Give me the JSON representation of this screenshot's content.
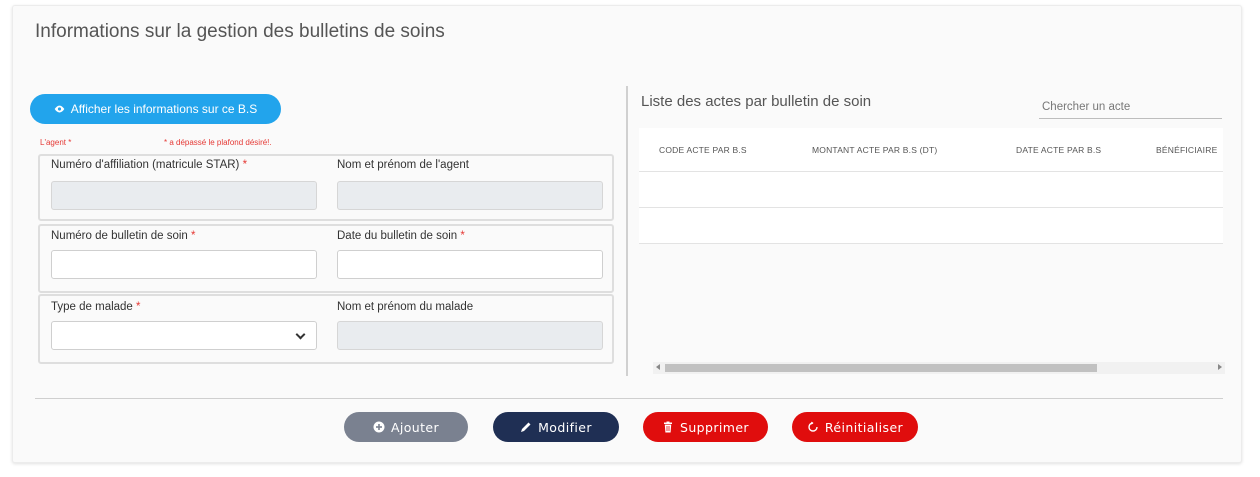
{
  "page": {
    "title": "Informations sur la gestion des bulletins de soins"
  },
  "info_button": {
    "label": "Afficher les informations sur ce B.S"
  },
  "warnings": {
    "agent_label": "L'agent *",
    "message": "* a dépassé le plafond désiré!."
  },
  "form": {
    "affiliation": {
      "label": "Numéro d'affiliation (matricule STAR)",
      "required": "*",
      "value": ""
    },
    "agent_name": {
      "label": "Nom et prénom de l'agent",
      "value": ""
    },
    "bulletin_number": {
      "label": "Numéro de bulletin de soin",
      "required": "*",
      "value": ""
    },
    "bulletin_date": {
      "label": "Date du bulletin de soin",
      "required": "*",
      "value": ""
    },
    "patient_type": {
      "label": "Type de malade",
      "required": "*",
      "value": ""
    },
    "patient_name": {
      "label": "Nom et prénom du malade",
      "value": ""
    }
  },
  "acts_list": {
    "title": "Liste des actes par bulletin de soin",
    "search_placeholder": "Chercher un acte",
    "columns": [
      "CODE ACTE PAR B.S",
      "MONTANT ACTE PAR B.S (DT)",
      "DATE ACTE PAR B.S",
      "BÉNÉFICIAIRE"
    ],
    "rows": [
      [
        "",
        "",
        "",
        ""
      ],
      [
        "",
        "",
        "",
        ""
      ]
    ]
  },
  "actions": {
    "add": "Ajouter",
    "modify": "Modifier",
    "delete": "Supprimer",
    "reset": "Réinitialiser"
  },
  "colors": {
    "primary_blue": "#22a4ec",
    "grey_button": "#7a8190",
    "navy_button": "#1f2f54",
    "danger_red": "#e00d0d",
    "required_red": "#e53935"
  }
}
